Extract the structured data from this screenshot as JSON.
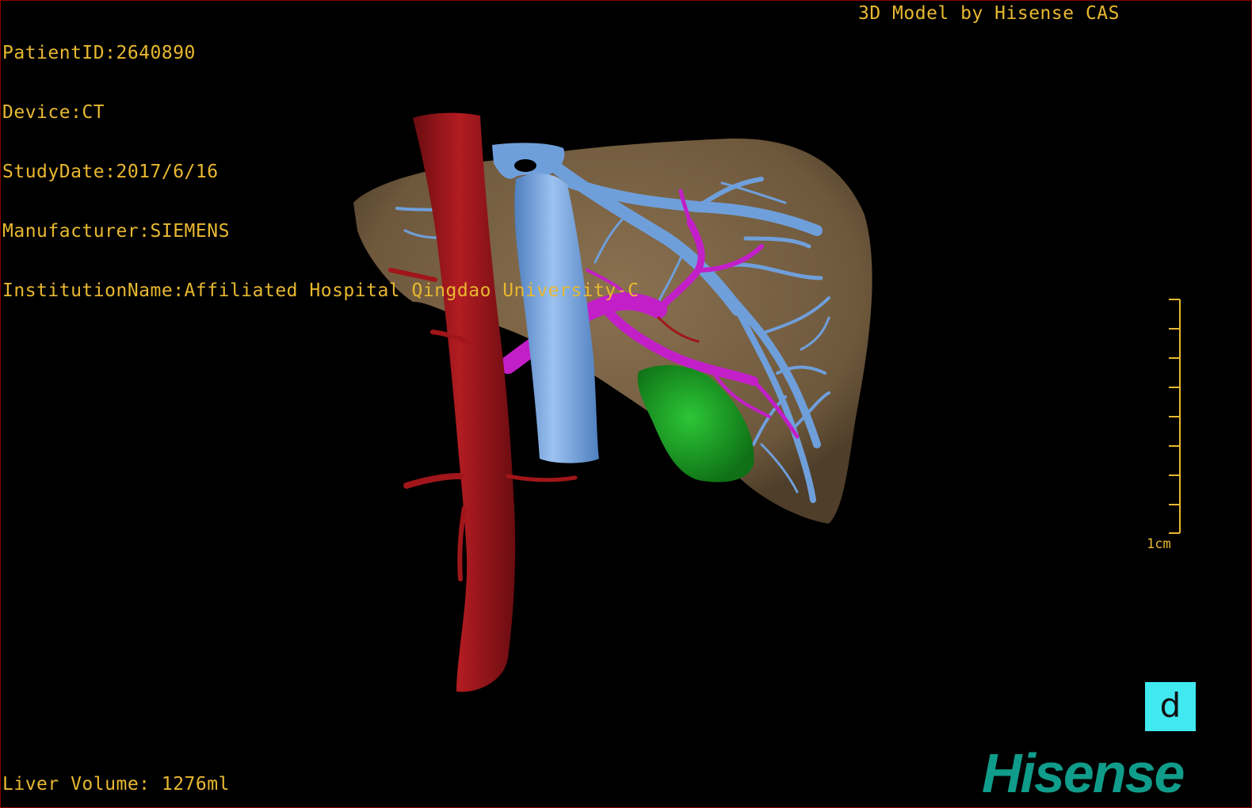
{
  "patient": {
    "lines": [
      "PatientID:2640890",
      "Device:CT",
      "StudyDate:2017/6/16",
      "Manufacturer:SIEMENS",
      "InstitutionName:Affiliated Hospital Qingdao University-C"
    ]
  },
  "model_credit": "3D Model by Hisense CAS",
  "liver_volume": "Liver Volume: 1276ml",
  "scale_bar": {
    "label": "1cm"
  },
  "orientation_cube": {
    "label": "d"
  },
  "brand": {
    "logo_text": "Hisense"
  },
  "colors": {
    "text": "#e8b830",
    "liver": "#7a6244",
    "artery": "#a0161a",
    "vein": "#6f9fdb",
    "portal": "#c21fc8",
    "lesion": "#1a9a22",
    "cube": "#40e8f0",
    "brand": "#109c8a"
  },
  "structures": [
    {
      "name": "liver"
    },
    {
      "name": "aorta"
    },
    {
      "name": "inferior-vena-cava"
    },
    {
      "name": "hepatic-veins"
    },
    {
      "name": "portal-vein"
    },
    {
      "name": "lesion"
    }
  ]
}
